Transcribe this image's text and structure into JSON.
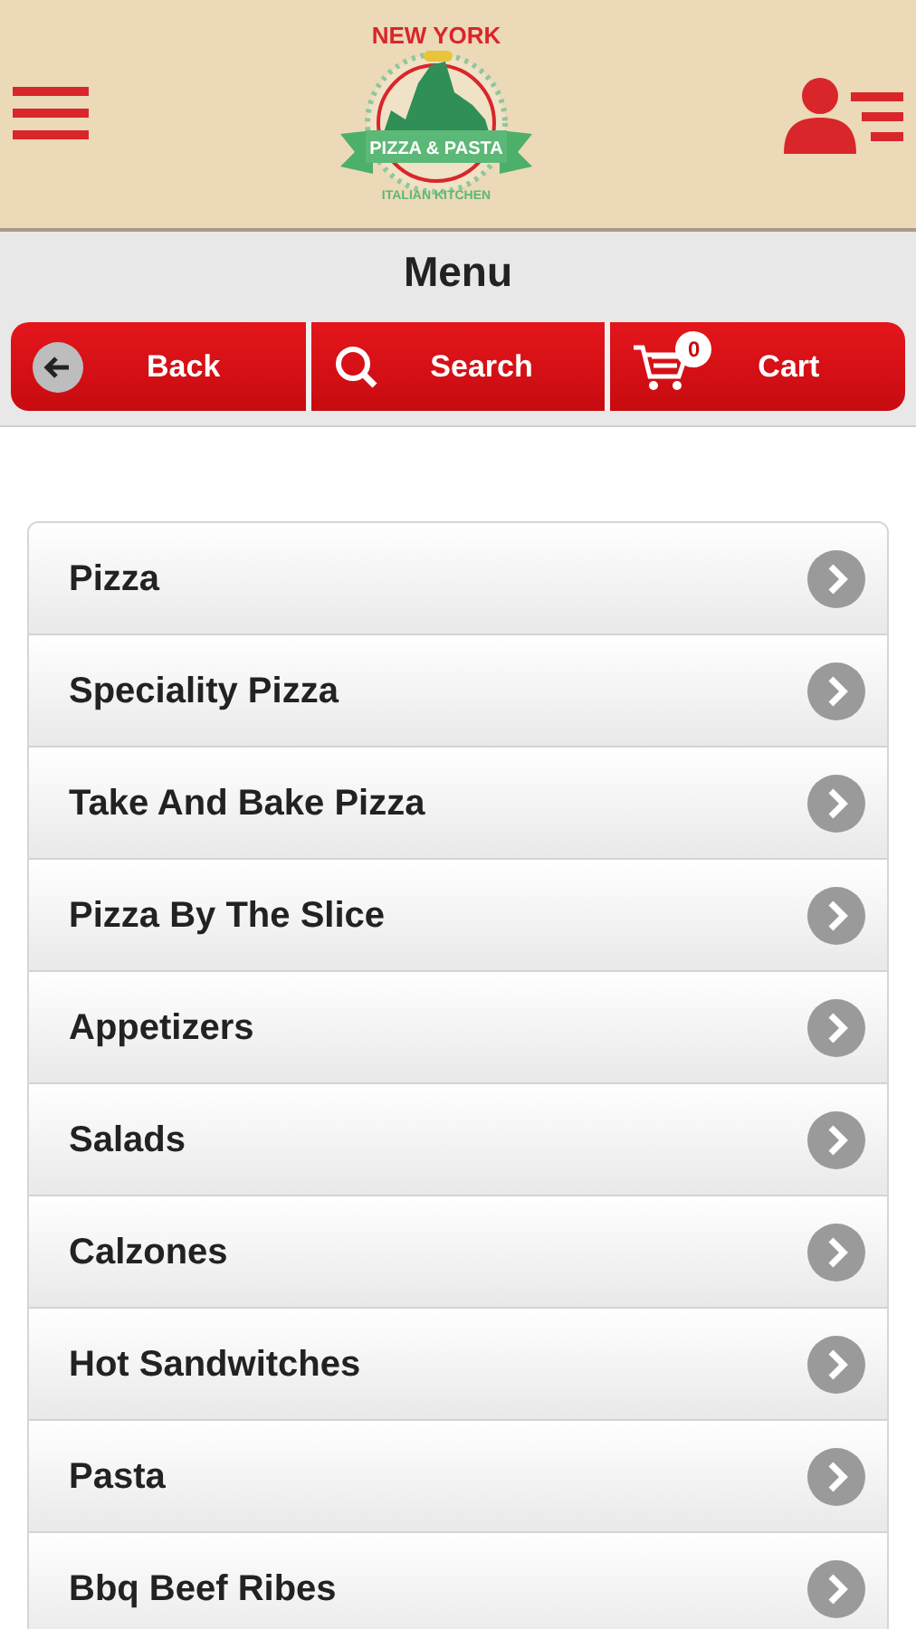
{
  "header": {
    "logo": {
      "top_text": "NEW YORK",
      "banner_text": "PIZZA & PASTA",
      "bottom_text": "ITALIAN KITCHEN"
    }
  },
  "title": "Menu",
  "toolbar": [
    {
      "kind": "back",
      "label": "Back"
    },
    {
      "kind": "search",
      "label": "Search"
    },
    {
      "kind": "cart",
      "label": "Cart",
      "badge": "0"
    }
  ],
  "categories": [
    "Pizza",
    "Speciality Pizza",
    "Take And Bake Pizza",
    "Pizza By The Slice",
    "Appetizers",
    "Salads",
    "Calzones",
    "Hot Sandwitches",
    "Pasta",
    "Bbq Beef Ribes"
  ]
}
